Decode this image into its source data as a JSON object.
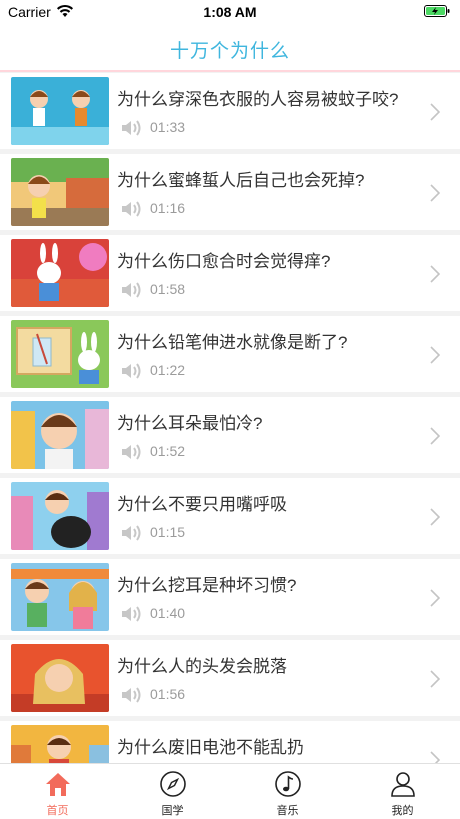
{
  "status_bar": {
    "carrier": "Carrier",
    "time": "1:08 AM"
  },
  "nav": {
    "title": "十万个为什么"
  },
  "colors": {
    "accent": "#3fb6de",
    "tab_active": "#f26b5b",
    "divider": "#ffd6dc"
  },
  "items": [
    {
      "title": "为什么穿深色衣服的人容易被蚊子咬?",
      "duration": "01:33"
    },
    {
      "title": "为什么蜜蜂蜇人后自己也会死掉?",
      "duration": "01:16"
    },
    {
      "title": "为什么伤口愈合时会觉得痒?",
      "duration": "01:58"
    },
    {
      "title": "为什么铅笔伸进水就像是断了?",
      "duration": "01:22"
    },
    {
      "title": "为什么耳朵最怕冷?",
      "duration": "01:52"
    },
    {
      "title": "为什么不要只用嘴呼吸",
      "duration": "01:15"
    },
    {
      "title": "为什么挖耳是种坏习惯?",
      "duration": "01:40"
    },
    {
      "title": "为什么人的头发会脱落",
      "duration": "01:56"
    },
    {
      "title": "为什么废旧电池不能乱扔",
      "duration": ""
    }
  ],
  "tabs": [
    {
      "label": "首页",
      "icon": "home-icon",
      "active": true
    },
    {
      "label": "国学",
      "icon": "compass-icon",
      "active": false
    },
    {
      "label": "音乐",
      "icon": "music-note-icon",
      "active": false
    },
    {
      "label": "我的",
      "icon": "user-icon",
      "active": false
    }
  ]
}
